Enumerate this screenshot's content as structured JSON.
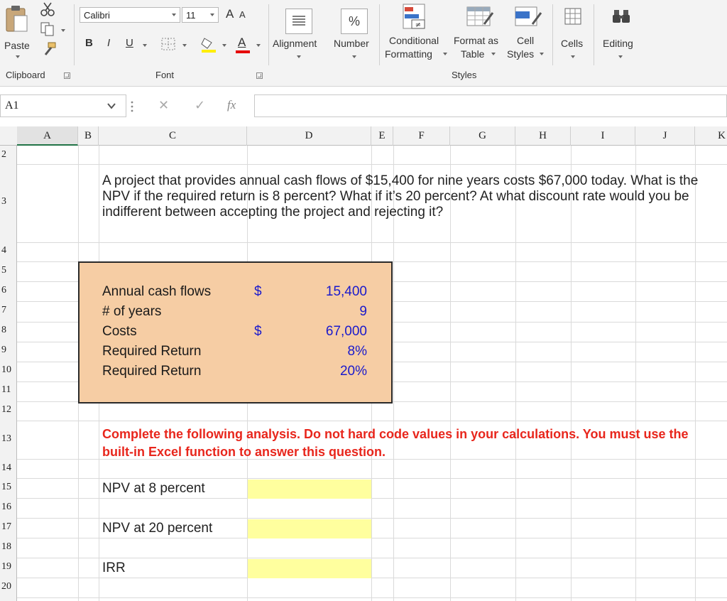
{
  "ribbon": {
    "clipboard": {
      "paste_label": "Paste",
      "group_label": "Clipboard"
    },
    "font": {
      "font_name": "Calibri",
      "font_size": "11",
      "bold": "B",
      "italic": "I",
      "underline": "U",
      "increase_size": "A",
      "decrease_size": "A",
      "font_color_glyph": "A",
      "group_label": "Font"
    },
    "alignment_label": "Alignment",
    "number_label": "Number",
    "number_glyph": "%",
    "styles": {
      "conditional_line1": "Conditional",
      "conditional_line2": "Formatting",
      "format_table_line1": "Format as",
      "format_table_line2": "Table",
      "cell_styles_line1": "Cell",
      "cell_styles_line2": "Styles",
      "group_label": "Styles"
    },
    "cells_label": "Cells",
    "editing_label": "Editing"
  },
  "formula_bar": {
    "name_box": "A1",
    "cancel_glyph": "✕",
    "enter_glyph": "✓",
    "fx_glyph": "fx",
    "formula_value": ""
  },
  "columns": [
    "A",
    "B",
    "C",
    "D",
    "E",
    "F",
    "G",
    "H",
    "I",
    "J",
    "K"
  ],
  "rows": [
    "2",
    "3",
    "4",
    "5",
    "6",
    "7",
    "8",
    "9",
    "10",
    "11",
    "12",
    "13",
    "14",
    "15",
    "16",
    "17",
    "18",
    "19",
    "20"
  ],
  "sheet": {
    "question": "A project that provides annual cash flows of $15,400 for nine years costs $67,000 today. What is the NPV if the required return is 8 percent? What if it’s 20 percent? At what discount rate would you be indifferent between accepting the project and rejecting it?",
    "inputs": [
      {
        "label": "Annual cash flows",
        "currency": "$",
        "value": "15,400"
      },
      {
        "label": "# of years",
        "currency": "",
        "value": "9"
      },
      {
        "label": "Costs",
        "currency": "$",
        "value": "67,000"
      },
      {
        "label": "Required Return",
        "currency": "",
        "value": "8%"
      },
      {
        "label": "Required Return",
        "currency": "",
        "value": "20%"
      }
    ],
    "instructions": "Complete the following analysis. Do not hard code values in your calculations. You must use the built-in Excel function to answer this question.",
    "outputs": [
      {
        "label": "NPV at 8 percent",
        "value": ""
      },
      {
        "label": "NPV at 20 percent",
        "value": ""
      },
      {
        "label": "IRR",
        "value": ""
      }
    ]
  },
  "colors": {
    "input_box_fill": "#f6cda4",
    "input_value_blue": "#1a1acc",
    "instruction_red": "#e8261c",
    "answer_fill": "#ffff9e",
    "ribbon_bg": "#f3f3f3"
  }
}
